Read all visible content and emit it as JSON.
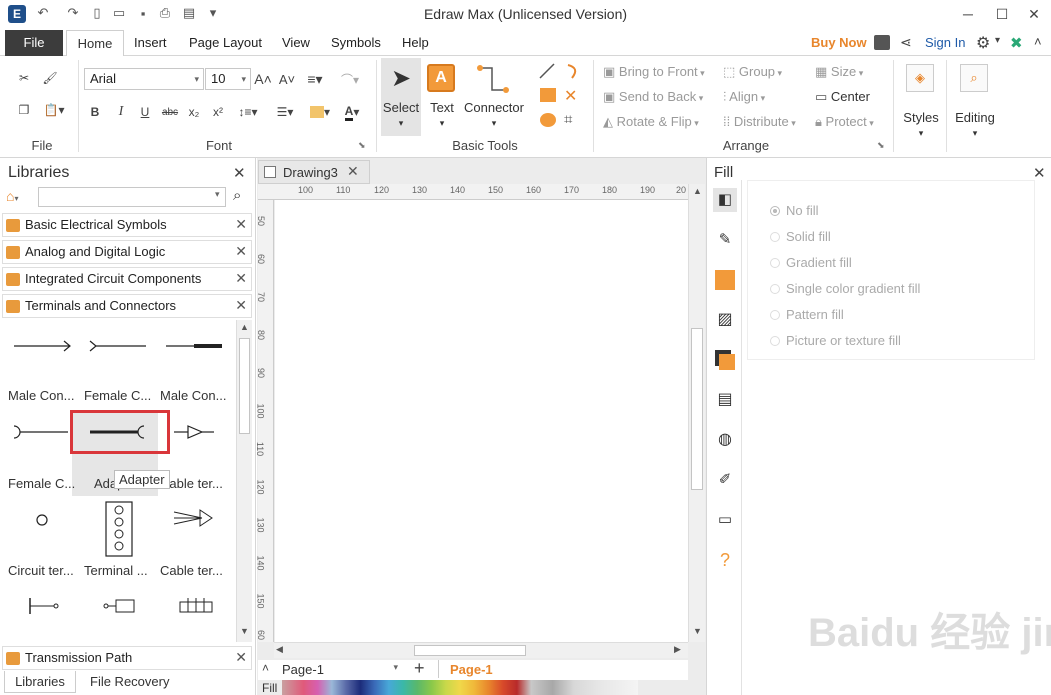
{
  "app": {
    "title": "Edraw Max (Unlicensed Version)"
  },
  "menubar": {
    "file": "File",
    "tabs": [
      "Home",
      "Insert",
      "Page Layout",
      "View",
      "Symbols",
      "Help"
    ],
    "buy_now": "Buy Now",
    "sign_in": "Sign In"
  },
  "ribbon": {
    "groups": {
      "file": "File",
      "font": "Font",
      "basic_tools": "Basic Tools",
      "arrange": "Arrange"
    },
    "font_name": "Arial",
    "font_size": "10",
    "tools": {
      "select": "Select",
      "text": "Text",
      "connector": "Connector"
    },
    "arrange": {
      "bring_to_front": "Bring to Front",
      "send_to_back": "Send to Back",
      "rotate_flip": "Rotate & Flip",
      "group": "Group",
      "align": "Align",
      "distribute": "Distribute",
      "size": "Size",
      "center": "Center",
      "protect": "Protect"
    },
    "styles": "Styles",
    "editing": "Editing"
  },
  "libraries": {
    "title": "Libraries",
    "search_value": "",
    "items": [
      "Basic Electrical Symbols",
      "Analog and Digital Logic",
      "Integrated Circuit Components",
      "Terminals and Connectors"
    ],
    "symbols": [
      "Male Con...",
      "Female C...",
      "Male Con...",
      "Female C...",
      "Adapter",
      "Cable ter...",
      "Circuit ter...",
      "Terminal ...",
      "Cable ter..."
    ],
    "tooltip": "Adapter",
    "transmission_path": "Transmission Path",
    "bottom_tabs": [
      "Libraries",
      "File Recovery"
    ]
  },
  "document": {
    "tab": "Drawing3",
    "ruler_top": [
      "100",
      "110",
      "120",
      "130",
      "140",
      "150",
      "160",
      "170",
      "180",
      "190",
      "20"
    ],
    "ruler_left": [
      "50",
      "60",
      "70",
      "80",
      "90",
      "100",
      "110",
      "120",
      "130",
      "140",
      "150",
      "60"
    ],
    "page_select": "Page-1",
    "page_tab": "Page-1",
    "fill_label": "Fill"
  },
  "fill_panel": {
    "title": "Fill",
    "options": [
      "No fill",
      "Solid fill",
      "Gradient fill",
      "Single color gradient fill",
      "Pattern fill",
      "Picture or texture fill"
    ]
  },
  "colors": {
    "accent": "#e8862c",
    "highlight_box": "#d9363a",
    "dark_tab": "#3c3c3c"
  },
  "watermark": "Baidu 经验 jingyan.baidu.com"
}
